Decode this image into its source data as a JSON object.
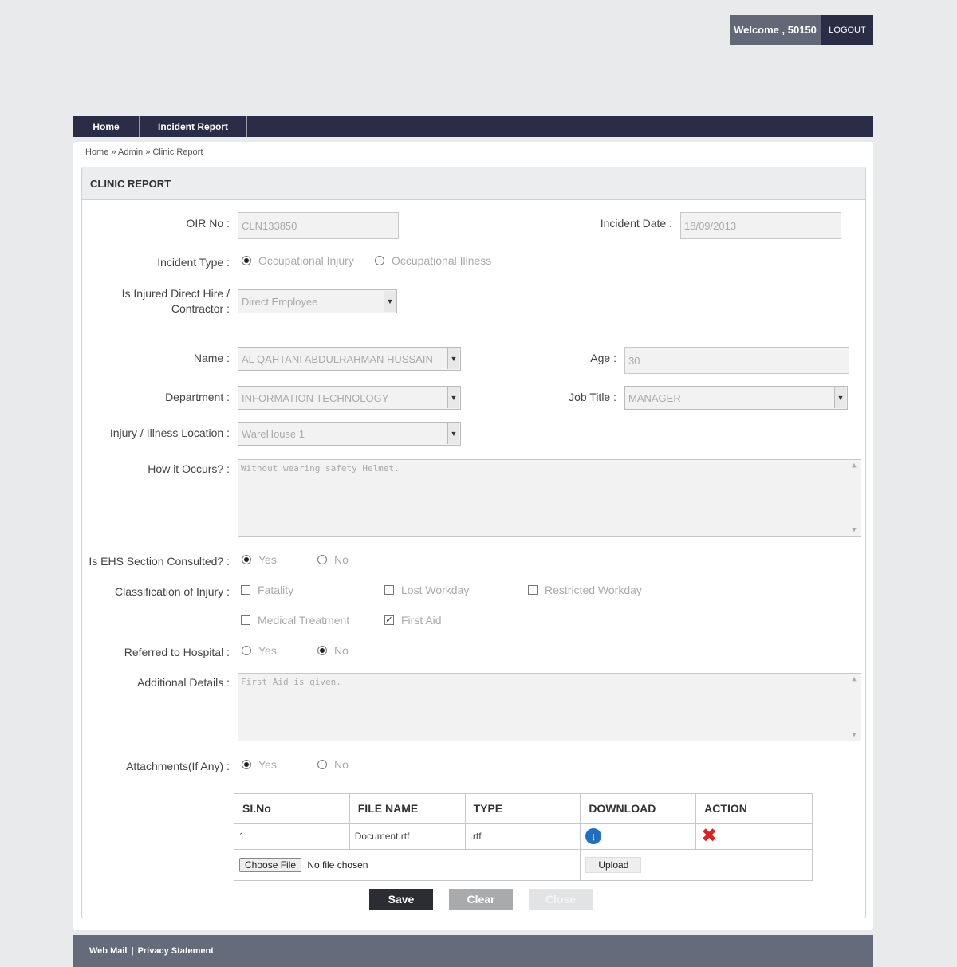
{
  "header": {
    "welcome": "Welcome , 50150",
    "logout": "LOGOUT"
  },
  "nav": {
    "home": "Home",
    "incident_report": "Incident Report"
  },
  "breadcrumb": {
    "home": "Home",
    "sep": "»",
    "admin": "Admin",
    "current": "Clinic Report"
  },
  "form": {
    "title": "CLINIC REPORT",
    "oir_no": {
      "label": "OIR No :",
      "value": "CLN133850"
    },
    "incident_date": {
      "label": "Incident Date :",
      "value": "18/09/2013"
    },
    "incident_type": {
      "label": "Incident Type :",
      "options": [
        "Occupational Injury",
        "Occupational Illness"
      ],
      "selected": "Occupational Injury"
    },
    "hire": {
      "label_line1": "Is Injured Direct Hire /",
      "label_line2": "Contractor :",
      "value": "Direct Employee"
    },
    "name": {
      "label": "Name :",
      "value": "AL QAHTANI ABDULRAHMAN HUSSAIN"
    },
    "age": {
      "label": "Age :",
      "value": "30"
    },
    "department": {
      "label": "Department :",
      "value": "INFORMATION TECHNOLOGY"
    },
    "job_title": {
      "label": "Job Title :",
      "value": "MANAGER"
    },
    "location": {
      "label": "Injury / Illness Location :",
      "value": "WareHouse 1"
    },
    "how": {
      "label": "How it Occurs? :",
      "value": "Without wearing safety Helmet."
    },
    "ehs": {
      "label": "Is EHS Section Consulted? :",
      "options": [
        "Yes",
        "No"
      ],
      "selected": "Yes"
    },
    "classification": {
      "label": "Classification of Injury :",
      "options": [
        "Fatality",
        "Lost Workday",
        "Restricted Workday",
        "Medical Treatment",
        "First Aid"
      ],
      "checked": [
        "First Aid"
      ]
    },
    "hospital": {
      "label": "Referred to Hospital :",
      "options": [
        "Yes",
        "No"
      ],
      "selected": "No"
    },
    "additional": {
      "label": "Additional Details :",
      "value": "First Aid is given."
    },
    "attachments": {
      "label": "Attachments(If Any) :",
      "options": [
        "Yes",
        "No"
      ],
      "selected": "Yes"
    }
  },
  "attachments_table": {
    "headers": [
      "SI.No",
      "FILE NAME",
      "TYPE",
      "DOWNLOAD",
      "ACTION"
    ],
    "rows": [
      {
        "sno": "1",
        "file_name": "Document.rtf",
        "type": ".rtf"
      }
    ],
    "choose_file": "Choose File",
    "no_file": "No file chosen",
    "upload": "Upload"
  },
  "buttons": {
    "save": "Save",
    "clear": "Clear",
    "close": "Close"
  },
  "footer": {
    "web_mail": "Web Mail",
    "sep": "|",
    "privacy": "Privacy Statement"
  }
}
